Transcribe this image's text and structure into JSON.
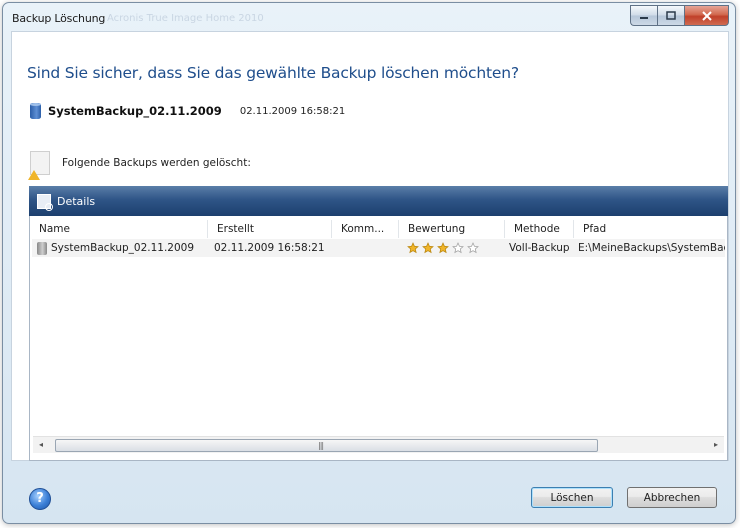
{
  "window": {
    "title": "Backup Löschung",
    "title_faint": "Acronis True Image Home 2010",
    "minimize_icon": "minimize-icon",
    "maximize_icon": "maximize-icon",
    "close_icon": "close-icon"
  },
  "dialog": {
    "question": "Sind Sie sicher, dass Sie das gewählte Backup löschen möchten?",
    "backup_name": "SystemBackup_02.11.2009",
    "backup_date": "02.11.2009 16:58:21",
    "info_text": "Folgende Backups werden gelöscht:"
  },
  "details": {
    "label": "Details",
    "columns": [
      "Name",
      "Erstellt",
      "Komm...",
      "Bewertung",
      "Methode",
      "Pfad"
    ],
    "rows": [
      {
        "name": "SystemBackup_02.11.2009",
        "created": "02.11.2009 16:58:21",
        "comment": "",
        "rating": 3,
        "rating_max": 5,
        "method": "Voll-Backup",
        "path": "E:\\MeineBackups\\SystemBackup"
      }
    ],
    "scroll_grip": "|||",
    "scroll_left": "◂",
    "scroll_right": "▸"
  },
  "footer": {
    "help_label": "?",
    "delete_label": "Löschen",
    "cancel_label": "Abbrechen"
  },
  "colors": {
    "accent_text": "#1f4e8c",
    "details_bar": "#2f5587",
    "star_filled": "#f0b52a",
    "star_empty": "#d9d9d9"
  }
}
